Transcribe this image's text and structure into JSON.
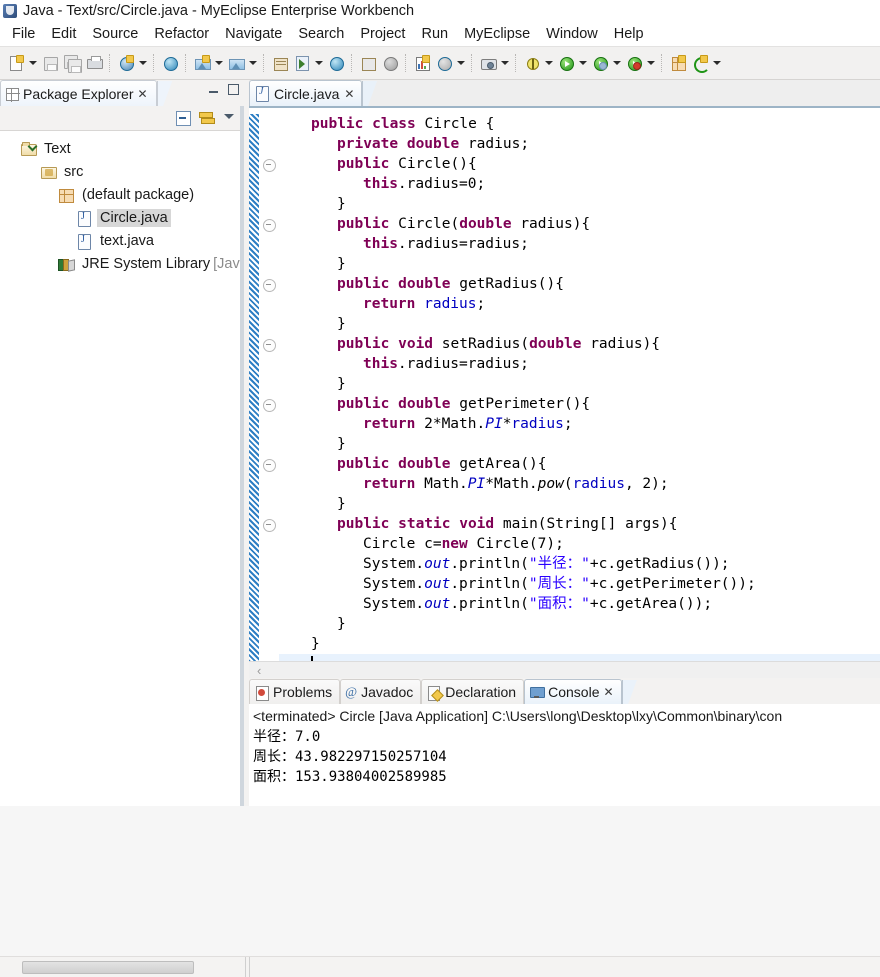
{
  "window": {
    "title": "Java - Text/src/Circle.java - MyEclipse Enterprise Workbench",
    "app_icon": "myeclipse-icon"
  },
  "menubar": {
    "items": [
      {
        "label": "File"
      },
      {
        "label": "Edit"
      },
      {
        "label": "Source"
      },
      {
        "label": "Refactor"
      },
      {
        "label": "Navigate"
      },
      {
        "label": "Search"
      },
      {
        "label": "Project"
      },
      {
        "label": "Run"
      },
      {
        "label": "MyEclipse"
      },
      {
        "label": "Window"
      },
      {
        "label": "Help"
      }
    ]
  },
  "toolbar": {
    "groups": [
      {
        "buttons": [
          {
            "icon": "new-wizard-icon",
            "has_dropdown": true
          },
          {
            "icon": "save-icon",
            "has_dropdown": false
          },
          {
            "icon": "save-all-icon",
            "has_dropdown": false
          },
          {
            "icon": "print-icon",
            "has_dropdown": false
          }
        ]
      },
      {
        "buttons": [
          {
            "icon": "new-myeclipse-project-icon",
            "has_dropdown": true
          }
        ]
      },
      {
        "buttons": [
          {
            "icon": "web-browser-icon",
            "has_dropdown": false
          }
        ]
      },
      {
        "buttons": [
          {
            "icon": "deploy-icon",
            "has_dropdown": true
          },
          {
            "icon": "server-icon",
            "has_dropdown": true
          }
        ]
      },
      {
        "buttons": [
          {
            "icon": "database-explorer-icon",
            "has_dropdown": false
          },
          {
            "icon": "run-server-icon",
            "has_dropdown": true
          },
          {
            "icon": "open-browser-icon",
            "has_dropdown": false
          }
        ]
      },
      {
        "buttons": [
          {
            "icon": "import-icon",
            "has_dropdown": false
          },
          {
            "icon": "export-icon",
            "has_dropdown": false
          }
        ]
      },
      {
        "buttons": [
          {
            "icon": "chart-report-icon",
            "has_dropdown": false
          },
          {
            "icon": "new-report-icon",
            "has_dropdown": true
          }
        ]
      },
      {
        "buttons": [
          {
            "icon": "snapshot-icon",
            "has_dropdown": true
          }
        ]
      },
      {
        "buttons": [
          {
            "icon": "debug-icon",
            "has_dropdown": true
          },
          {
            "icon": "run-icon",
            "has_dropdown": true
          },
          {
            "icon": "run-history-icon",
            "has_dropdown": true
          },
          {
            "icon": "profile-icon",
            "has_dropdown": true
          }
        ]
      },
      {
        "buttons": [
          {
            "icon": "new-java-package-icon",
            "has_dropdown": false
          },
          {
            "icon": "refresh-icon",
            "has_dropdown": true
          }
        ]
      }
    ]
  },
  "package_explorer": {
    "tab_label": "Package Explorer",
    "close_glyph": "✕",
    "view_toolbar": [
      {
        "icon": "collapse-all-icon"
      },
      {
        "icon": "link-with-editor-icon"
      },
      {
        "icon": "view-menu-icon"
      }
    ],
    "tree": [
      {
        "label": "Text",
        "icon": "project-folder-icon",
        "indent": 0,
        "selected": false
      },
      {
        "label": "src",
        "icon": "source-folder-icon",
        "indent": 1,
        "selected": false
      },
      {
        "label": "(default package)",
        "icon": "package-icon",
        "indent": 2,
        "selected": false
      },
      {
        "label": "Circle.java",
        "icon": "java-file-icon",
        "indent": 3,
        "selected": true
      },
      {
        "label": "text.java",
        "icon": "java-file-icon",
        "indent": 3,
        "selected": false
      },
      {
        "label": "JRE System Library",
        "label_dim": " [JavaS",
        "icon": "jre-library-icon",
        "indent": 2,
        "selected": false
      }
    ]
  },
  "editor": {
    "tab": {
      "label": "Circle.java",
      "icon": "java-file-icon",
      "close_glyph": "✕"
    },
    "scroll_left_glyph": "‹",
    "code_lines": [
      {
        "fold": false,
        "tokens": [
          {
            "t": "public ",
            "c": "kw"
          },
          {
            "t": "class ",
            "c": "kw"
          },
          {
            "t": "Circle {",
            "c": ""
          }
        ],
        "indent": 0
      },
      {
        "fold": false,
        "tokens": [
          {
            "t": "private ",
            "c": "kw"
          },
          {
            "t": "double ",
            "c": "kw"
          },
          {
            "t": "radius;",
            "c": ""
          }
        ],
        "indent": 1
      },
      {
        "fold": true,
        "tokens": [
          {
            "t": "public ",
            "c": "kw"
          },
          {
            "t": "Circle(){",
            "c": ""
          }
        ],
        "indent": 1
      },
      {
        "fold": false,
        "tokens": [
          {
            "t": "this",
            "c": "kw"
          },
          {
            "t": ".radius=0;",
            "c": ""
          }
        ],
        "indent": 2
      },
      {
        "fold": false,
        "tokens": [
          {
            "t": "}",
            "c": ""
          }
        ],
        "indent": 1
      },
      {
        "fold": true,
        "tokens": [
          {
            "t": "public ",
            "c": "kw"
          },
          {
            "t": "Circle(",
            "c": ""
          },
          {
            "t": "double ",
            "c": "kw"
          },
          {
            "t": "radius){",
            "c": ""
          }
        ],
        "indent": 1
      },
      {
        "fold": false,
        "tokens": [
          {
            "t": "this",
            "c": "kw"
          },
          {
            "t": ".radius=radius;",
            "c": ""
          }
        ],
        "indent": 2
      },
      {
        "fold": false,
        "tokens": [
          {
            "t": "}",
            "c": ""
          }
        ],
        "indent": 1
      },
      {
        "fold": true,
        "tokens": [
          {
            "t": "public ",
            "c": "kw"
          },
          {
            "t": "double ",
            "c": "kw"
          },
          {
            "t": "getRadius(){",
            "c": ""
          }
        ],
        "indent": 1
      },
      {
        "fold": false,
        "tokens": [
          {
            "t": "return ",
            "c": "kw"
          },
          {
            "t": "radius",
            "c": "fld"
          },
          {
            "t": ";",
            "c": ""
          }
        ],
        "indent": 2
      },
      {
        "fold": false,
        "tokens": [
          {
            "t": "}",
            "c": ""
          }
        ],
        "indent": 1
      },
      {
        "fold": true,
        "tokens": [
          {
            "t": "public ",
            "c": "kw"
          },
          {
            "t": "void ",
            "c": "kw"
          },
          {
            "t": "setRadius(",
            "c": ""
          },
          {
            "t": "double ",
            "c": "kw"
          },
          {
            "t": "radius){",
            "c": ""
          }
        ],
        "indent": 1
      },
      {
        "fold": false,
        "tokens": [
          {
            "t": "this",
            "c": "kw"
          },
          {
            "t": ".radius=radius;",
            "c": ""
          }
        ],
        "indent": 2
      },
      {
        "fold": false,
        "tokens": [
          {
            "t": "}",
            "c": ""
          }
        ],
        "indent": 1
      },
      {
        "fold": true,
        "tokens": [
          {
            "t": "public ",
            "c": "kw"
          },
          {
            "t": "double ",
            "c": "kw"
          },
          {
            "t": "getPerimeter(){",
            "c": ""
          }
        ],
        "indent": 1
      },
      {
        "fold": false,
        "tokens": [
          {
            "t": "return ",
            "c": "kw"
          },
          {
            "t": "2*Math.",
            "c": ""
          },
          {
            "t": "PI",
            "c": "fld stat"
          },
          {
            "t": "*",
            "c": ""
          },
          {
            "t": "radius",
            "c": "fld"
          },
          {
            "t": ";",
            "c": ""
          }
        ],
        "indent": 2
      },
      {
        "fold": false,
        "tokens": [
          {
            "t": "}",
            "c": ""
          }
        ],
        "indent": 1
      },
      {
        "fold": true,
        "tokens": [
          {
            "t": "public ",
            "c": "kw"
          },
          {
            "t": "double ",
            "c": "kw"
          },
          {
            "t": "getArea(){",
            "c": ""
          }
        ],
        "indent": 1
      },
      {
        "fold": false,
        "tokens": [
          {
            "t": "return ",
            "c": "kw"
          },
          {
            "t": "Math.",
            "c": ""
          },
          {
            "t": "PI",
            "c": "fld stat"
          },
          {
            "t": "*Math.",
            "c": ""
          },
          {
            "t": "pow",
            "c": "stat"
          },
          {
            "t": "(",
            "c": ""
          },
          {
            "t": "radius",
            "c": "fld"
          },
          {
            "t": ", 2);",
            "c": ""
          }
        ],
        "indent": 2
      },
      {
        "fold": false,
        "tokens": [
          {
            "t": "}",
            "c": ""
          }
        ],
        "indent": 1
      },
      {
        "fold": true,
        "tokens": [
          {
            "t": "public ",
            "c": "kw"
          },
          {
            "t": "static ",
            "c": "kw"
          },
          {
            "t": "void ",
            "c": "kw"
          },
          {
            "t": "main(String[] args){",
            "c": ""
          }
        ],
        "indent": 1
      },
      {
        "fold": false,
        "tokens": [
          {
            "t": "Circle c=",
            "c": ""
          },
          {
            "t": "new ",
            "c": "kw"
          },
          {
            "t": "Circle(7);",
            "c": ""
          }
        ],
        "indent": 2
      },
      {
        "fold": false,
        "tokens": [
          {
            "t": "System.",
            "c": ""
          },
          {
            "t": "out",
            "c": "fld stat"
          },
          {
            "t": ".println(",
            "c": ""
          },
          {
            "t": "\"半径：\"",
            "c": "str"
          },
          {
            "t": "+c.getRadius());",
            "c": ""
          }
        ],
        "indent": 2
      },
      {
        "fold": false,
        "tokens": [
          {
            "t": "System.",
            "c": ""
          },
          {
            "t": "out",
            "c": "fld stat"
          },
          {
            "t": ".println(",
            "c": ""
          },
          {
            "t": "\"周长：\"",
            "c": "str"
          },
          {
            "t": "+c.getPerimeter());",
            "c": ""
          }
        ],
        "indent": 2
      },
      {
        "fold": false,
        "tokens": [
          {
            "t": "System.",
            "c": ""
          },
          {
            "t": "out",
            "c": "fld stat"
          },
          {
            "t": ".println(",
            "c": ""
          },
          {
            "t": "\"面积：\"",
            "c": "str"
          },
          {
            "t": "+c.getArea());",
            "c": ""
          }
        ],
        "indent": 2
      },
      {
        "fold": false,
        "tokens": [
          {
            "t": "}",
            "c": ""
          }
        ],
        "indent": 1
      },
      {
        "fold": false,
        "tokens": [
          {
            "t": "}",
            "c": ""
          }
        ],
        "indent": 0
      },
      {
        "fold": false,
        "tokens": [],
        "indent": 0,
        "current": true
      }
    ]
  },
  "bottom_panel": {
    "tabs": [
      {
        "label": "Problems",
        "icon": "problems-icon",
        "active": false
      },
      {
        "label": "Javadoc",
        "icon": "javadoc-icon",
        "active": false
      },
      {
        "label": "Declaration",
        "icon": "declaration-icon",
        "active": false
      },
      {
        "label": "Console",
        "icon": "console-icon",
        "active": true,
        "close_glyph": "✕"
      }
    ],
    "console": {
      "header": "<terminated> Circle [Java Application] C:\\Users\\long\\Desktop\\lxy\\Common\\binary\\con",
      "lines": [
        "半径：7.0",
        "周长：43.982297150257104",
        "面积：153.93804002589985"
      ]
    }
  },
  "colors": {
    "keyword": "#7f0055",
    "string": "#2a00ff",
    "field": "#0000c0",
    "current_line": "#e8f2fd",
    "change_bar": "#2e7fc4",
    "selection": "#d7d7d7"
  }
}
